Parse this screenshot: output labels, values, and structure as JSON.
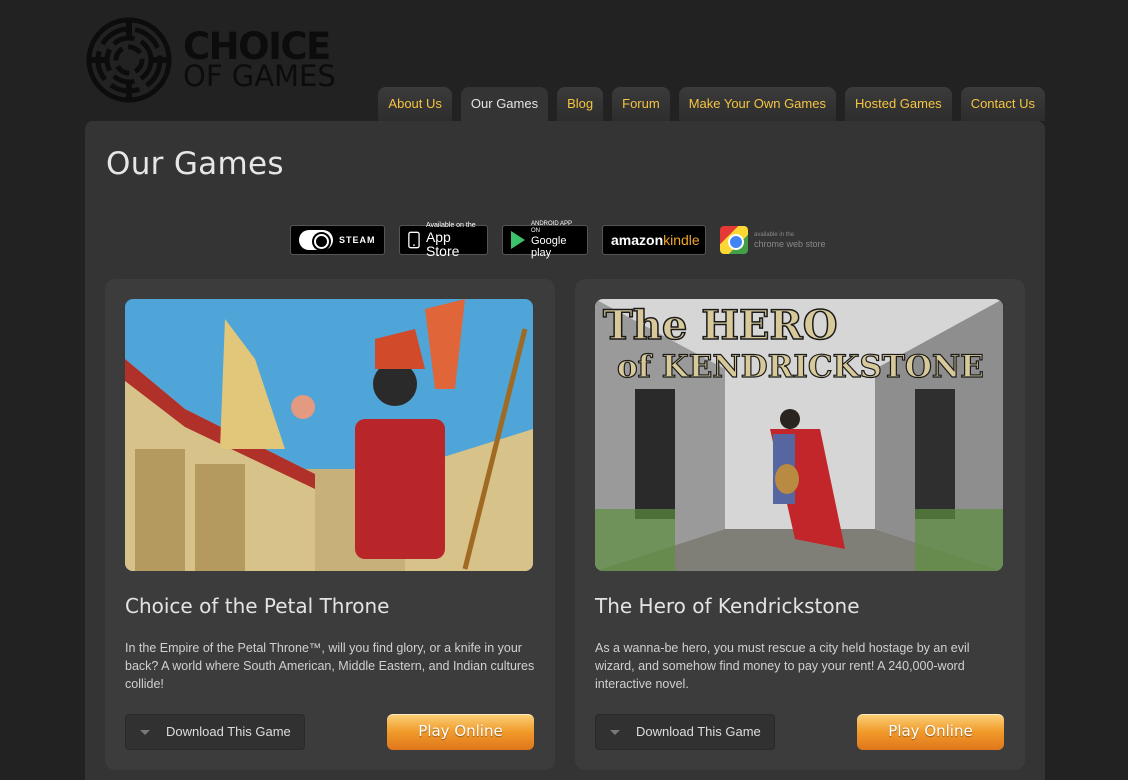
{
  "logo": {
    "line1": "CHOICE",
    "line2": "OF GAMES"
  },
  "nav": [
    {
      "label": "About Us",
      "active": false
    },
    {
      "label": "Our Games",
      "active": true
    },
    {
      "label": "Blog",
      "active": false
    },
    {
      "label": "Forum",
      "active": false
    },
    {
      "label": "Make Your Own Games",
      "active": false
    },
    {
      "label": "Hosted Games",
      "active": false
    },
    {
      "label": "Contact Us",
      "active": false
    }
  ],
  "page_title": "Our Games",
  "badges": {
    "steam": "STEAM",
    "appstore_small": "Available on the",
    "appstore_big": "App Store",
    "googleplay_small": "ANDROID APP ON",
    "googleplay_big": "Google play",
    "kindle_amazon": "amazon",
    "kindle_kindle": "kindle",
    "chrome_small": "available in the",
    "chrome_big": "chrome web store"
  },
  "games": [
    {
      "title": "Choice of the Petal Throne",
      "description": "In the Empire of the Petal Throne™, will you find glory, or a knife in your back? A world where South American, Middle Eastern, and Indian cultures collide!",
      "download_label": "Download This Game",
      "play_label": "Play Online"
    },
    {
      "title": "The Hero of Kendrickstone",
      "image_title_1": "The HERO",
      "image_title_2": "of KENDRICKSTONE",
      "description": "As a wanna-be hero, you must rescue a city held hostage by an evil wizard, and somehow find money to pay your rent! A 240,000-word interactive novel.",
      "download_label": "Download This Game",
      "play_label": "Play Online"
    }
  ]
}
